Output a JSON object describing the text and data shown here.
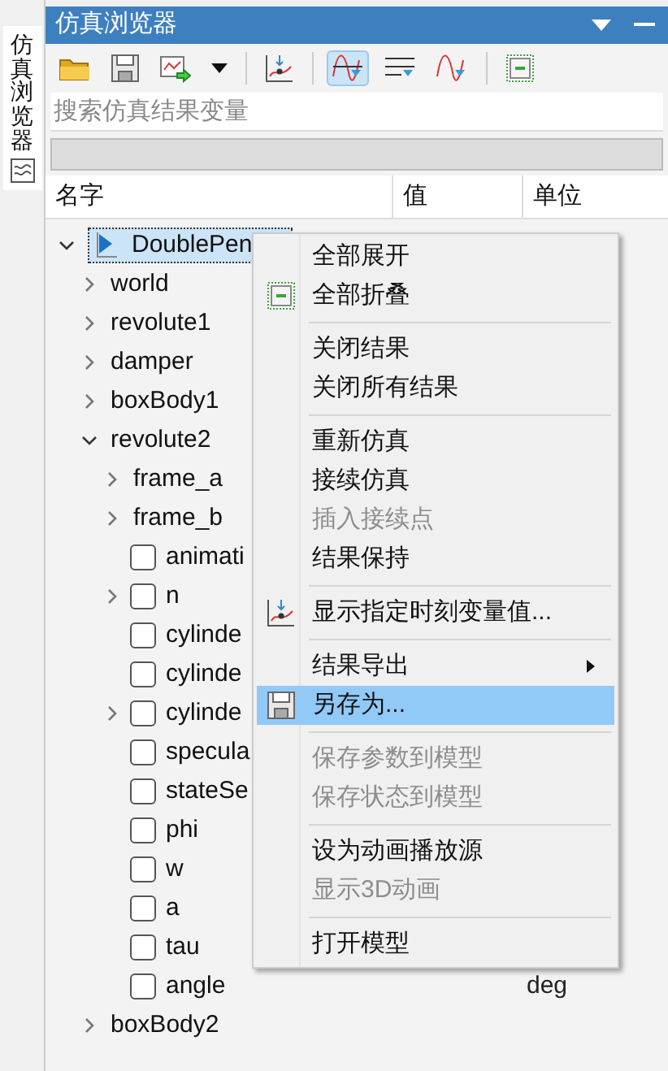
{
  "side_tab": {
    "label": "仿真浏览器"
  },
  "panel": {
    "title": "仿真浏览器"
  },
  "toolbar": [
    {
      "kind": "folder",
      "selected": false
    },
    {
      "kind": "save",
      "selected": false
    },
    {
      "kind": "export",
      "selected": false
    },
    {
      "kind": "caret",
      "selected": false
    },
    {
      "kind": "sep"
    },
    {
      "kind": "marker",
      "selected": false
    },
    {
      "kind": "sep"
    },
    {
      "kind": "curve",
      "selected": true
    },
    {
      "kind": "lines",
      "selected": false
    },
    {
      "kind": "curve2",
      "selected": false
    },
    {
      "kind": "sep"
    },
    {
      "kind": "collapse",
      "selected": false
    }
  ],
  "search": {
    "placeholder": "搜索仿真结果变量"
  },
  "columns": [
    "名字",
    "值",
    "单位"
  ],
  "tree": [
    {
      "label": "DoublePen",
      "kind": "model",
      "selected": true,
      "expanded": true,
      "children": [
        {
          "label": "world",
          "kind": "node",
          "expanded": false
        },
        {
          "label": "revolute1",
          "kind": "node",
          "expanded": false
        },
        {
          "label": "damper",
          "kind": "node",
          "expanded": false
        },
        {
          "label": "boxBody1",
          "kind": "node",
          "expanded": false
        },
        {
          "label": "revolute2",
          "kind": "node",
          "expanded": true,
          "children": [
            {
              "label": "frame_a",
              "kind": "node",
              "expanded": false
            },
            {
              "label": "frame_b",
              "kind": "node",
              "expanded": false
            },
            {
              "label": "animati",
              "kind": "var",
              "checked": false
            },
            {
              "label": "n",
              "kind": "var",
              "checked": false,
              "expanded": false
            },
            {
              "label": "cylinde",
              "kind": "var",
              "checked": false
            },
            {
              "label": "cylinde",
              "kind": "var",
              "checked": false
            },
            {
              "label": "cylinde",
              "kind": "var",
              "checked": false,
              "expanded": false
            },
            {
              "label": "specula",
              "kind": "var",
              "checked": false
            },
            {
              "label": "stateSe",
              "kind": "var",
              "checked": false
            },
            {
              "label": "phi",
              "kind": "var",
              "checked": false
            },
            {
              "label": "w",
              "kind": "var",
              "checked": false
            },
            {
              "label": "a",
              "kind": "var",
              "checked": false
            },
            {
              "label": "tau",
              "kind": "var",
              "checked": false
            },
            {
              "label": "angle",
              "kind": "var",
              "checked": false,
              "unit": "deg"
            }
          ]
        },
        {
          "label": "boxBody2",
          "kind": "node",
          "expanded": false
        }
      ]
    }
  ],
  "context_menu": [
    {
      "kind": "item",
      "label": "全部展开",
      "disabled": false,
      "selected": false
    },
    {
      "kind": "collapse",
      "label": "全部折叠",
      "disabled": false,
      "selected": false
    },
    {
      "kind": "separator"
    },
    {
      "kind": "item",
      "label": "关闭结果",
      "disabled": false,
      "selected": false
    },
    {
      "kind": "item",
      "label": "关闭所有结果",
      "disabled": false,
      "selected": false
    },
    {
      "kind": "separator"
    },
    {
      "kind": "item",
      "label": "重新仿真",
      "disabled": false,
      "selected": false
    },
    {
      "kind": "item",
      "label": "接续仿真",
      "disabled": false,
      "selected": false
    },
    {
      "kind": "item",
      "label": "插入接续点",
      "disabled": true,
      "selected": false
    },
    {
      "kind": "item",
      "label": "结果保持",
      "disabled": false,
      "selected": false
    },
    {
      "kind": "separator"
    },
    {
      "kind": "marker",
      "label": "显示指定时刻变量值...",
      "disabled": false,
      "selected": false
    },
    {
      "kind": "separator"
    },
    {
      "kind": "submenu",
      "label": "结果导出",
      "disabled": false,
      "selected": false
    },
    {
      "kind": "save",
      "label": "另存为...",
      "disabled": false,
      "selected": true
    },
    {
      "kind": "separator"
    },
    {
      "kind": "item",
      "label": "保存参数到模型",
      "disabled": true,
      "selected": false
    },
    {
      "kind": "item",
      "label": "保存状态到模型",
      "disabled": true,
      "selected": false
    },
    {
      "kind": "separator"
    },
    {
      "kind": "item",
      "label": "设为动画播放源",
      "disabled": false,
      "selected": false
    },
    {
      "kind": "item",
      "label": "显示3D动画",
      "disabled": true,
      "selected": false
    },
    {
      "kind": "separator"
    },
    {
      "kind": "item",
      "label": "打开模型",
      "disabled": false,
      "selected": false
    }
  ]
}
